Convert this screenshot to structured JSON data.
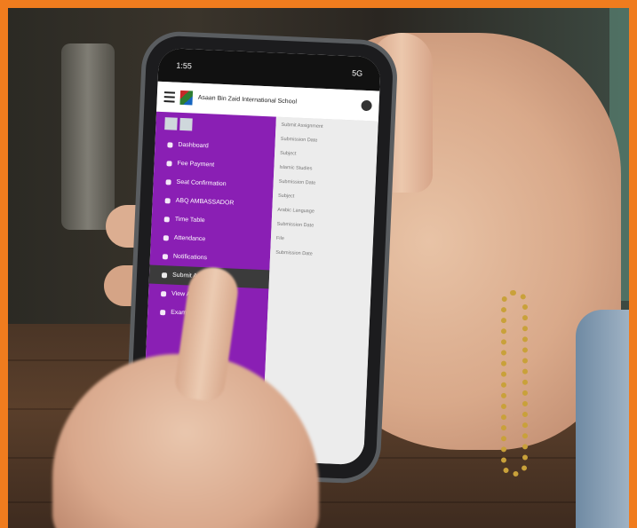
{
  "phone": {
    "status_time": "1:55",
    "status_right": "5G",
    "school_name": "Asaan Bin Zaid International School"
  },
  "menu": [
    {
      "label": "Dashboard",
      "icon": "home-icon"
    },
    {
      "label": "Fee Payment",
      "icon": "card-icon"
    },
    {
      "label": "Seat Confirmation",
      "icon": "check-icon"
    },
    {
      "label": "ABQ AMBASSADOR",
      "icon": "star-icon"
    },
    {
      "label": "Time Table",
      "icon": "clock-icon"
    },
    {
      "label": "Attendance",
      "icon": "calendar-icon"
    },
    {
      "label": "Notifications",
      "icon": "bell-icon"
    },
    {
      "label": "Submit Assignment",
      "icon": "upload-icon",
      "active": true
    },
    {
      "label": "View Assignment",
      "icon": "eye-icon"
    },
    {
      "label": "Exam Results",
      "icon": "doc-icon"
    }
  ],
  "panel": {
    "header": "Submit Assignment",
    "lines": [
      "Submission Date",
      "Subject",
      "Islamic Studies",
      "Submission Date",
      "Subject",
      "Arabic Language",
      "Submission Date",
      "File",
      "Submission Date"
    ]
  },
  "colors": {
    "frame": "#f07c1e",
    "drawer": "#8a1fb4",
    "active_item": "#3b3b3b"
  }
}
